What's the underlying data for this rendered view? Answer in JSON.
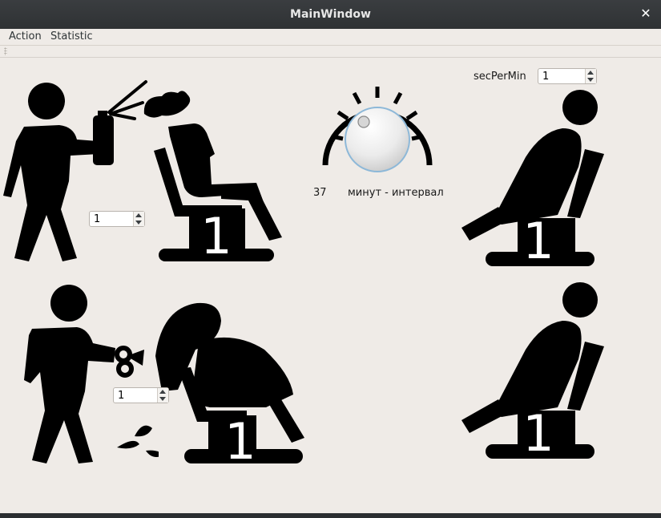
{
  "window": {
    "title": "MainWindow",
    "close_glyph": "✕"
  },
  "menu": {
    "items": [
      "Action",
      "Statistic"
    ]
  },
  "controls": {
    "sec_per_min_label": "secPerMin",
    "sec_per_min_value": "1",
    "spray_station_value": "1",
    "cut_station_value": "1",
    "dial_value": "37",
    "dial_caption": "минут - интервал",
    "dial_fraction": 0.45
  },
  "stations": {
    "spray_chair_count": "1",
    "top_waiting_chair_count": "1",
    "cut_chair_count": "1",
    "bottom_waiting_chair_count": "1"
  },
  "icons": {
    "spray_barber": "barber-spray-icon",
    "cut_barber": "barber-scissors-icon",
    "waiting_client": "seated-client-icon",
    "dial": "knob-dial-icon"
  }
}
